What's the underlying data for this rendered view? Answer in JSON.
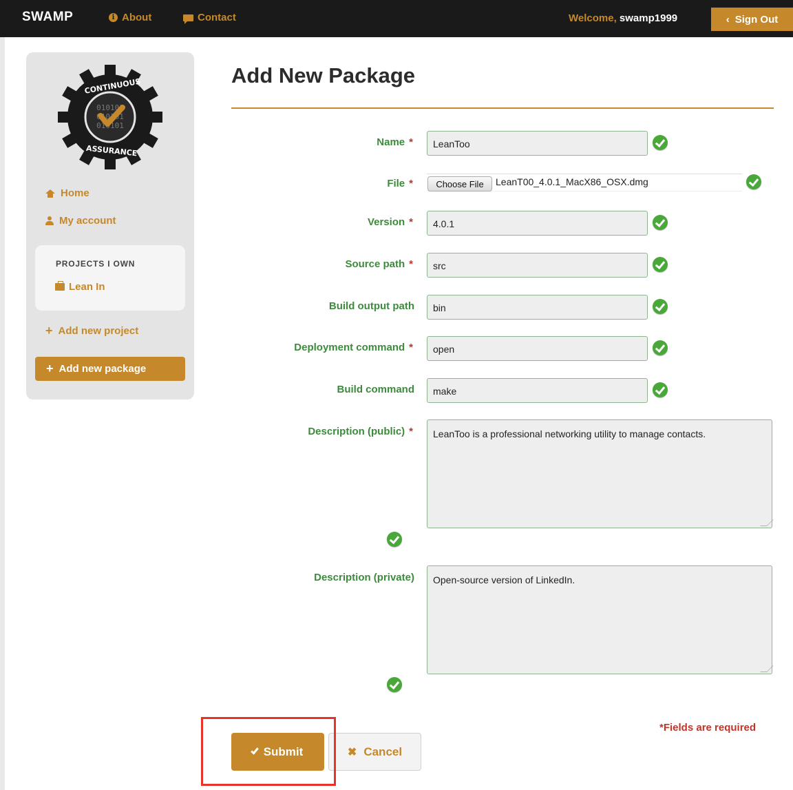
{
  "header": {
    "brand": "SWAMP",
    "about": "About",
    "contact": "Contact",
    "welcome_prefix": "Welcome,",
    "username": "swamp1999",
    "signout": "Sign Out"
  },
  "sidebar": {
    "logo_text_top": "CONTINUOUS",
    "logo_text_bottom": "ASSURANCE",
    "home": "Home",
    "my_account": "My account",
    "projects_title": "PROJECTS I OWN",
    "project_item": "Lean In",
    "add_project": "Add new project",
    "add_package": "Add new package"
  },
  "form": {
    "title": "Add New Package",
    "fields": {
      "name": {
        "label": "Name",
        "value": "LeanToo",
        "required": "*"
      },
      "file": {
        "label": "File",
        "button": "Choose File",
        "filename": "LeanT00_4.0.1_MacX86_OSX.dmg",
        "required": "*"
      },
      "version": {
        "label": "Version",
        "value": "4.0.1",
        "required": "*"
      },
      "source_path": {
        "label": "Source path",
        "value": "src",
        "required": "*"
      },
      "build_output_path": {
        "label": "Build output path",
        "value": "bin"
      },
      "deployment_command": {
        "label": "Deployment command",
        "value": "open",
        "required": "*"
      },
      "build_command": {
        "label": "Build command",
        "value": "make"
      },
      "description_public": {
        "label": "Description (public)",
        "value": "LeanToo is a professional networking utility to manage contacts.",
        "required": "*"
      },
      "description_private": {
        "label": "Description (private)",
        "value": "Open-source version of LinkedIn."
      }
    },
    "required_note": "*Fields are required",
    "submit": "Submit",
    "cancel": "Cancel"
  },
  "colors": {
    "accent": "#c5882a",
    "label_green": "#3d8a3d",
    "required_red": "#c0352a",
    "topbar": "#1a1a1a",
    "highlight": "#e8332a"
  },
  "icons": {
    "about": "info-circle-icon",
    "contact": "speech-bubble-icon",
    "signout": "chevron-left-icon",
    "home": "home-icon",
    "account": "user-icon",
    "project": "briefcase-icon",
    "add": "plus-icon",
    "valid": "check-circle-icon",
    "submit": "checkmark-icon",
    "cancel": "x-icon"
  }
}
